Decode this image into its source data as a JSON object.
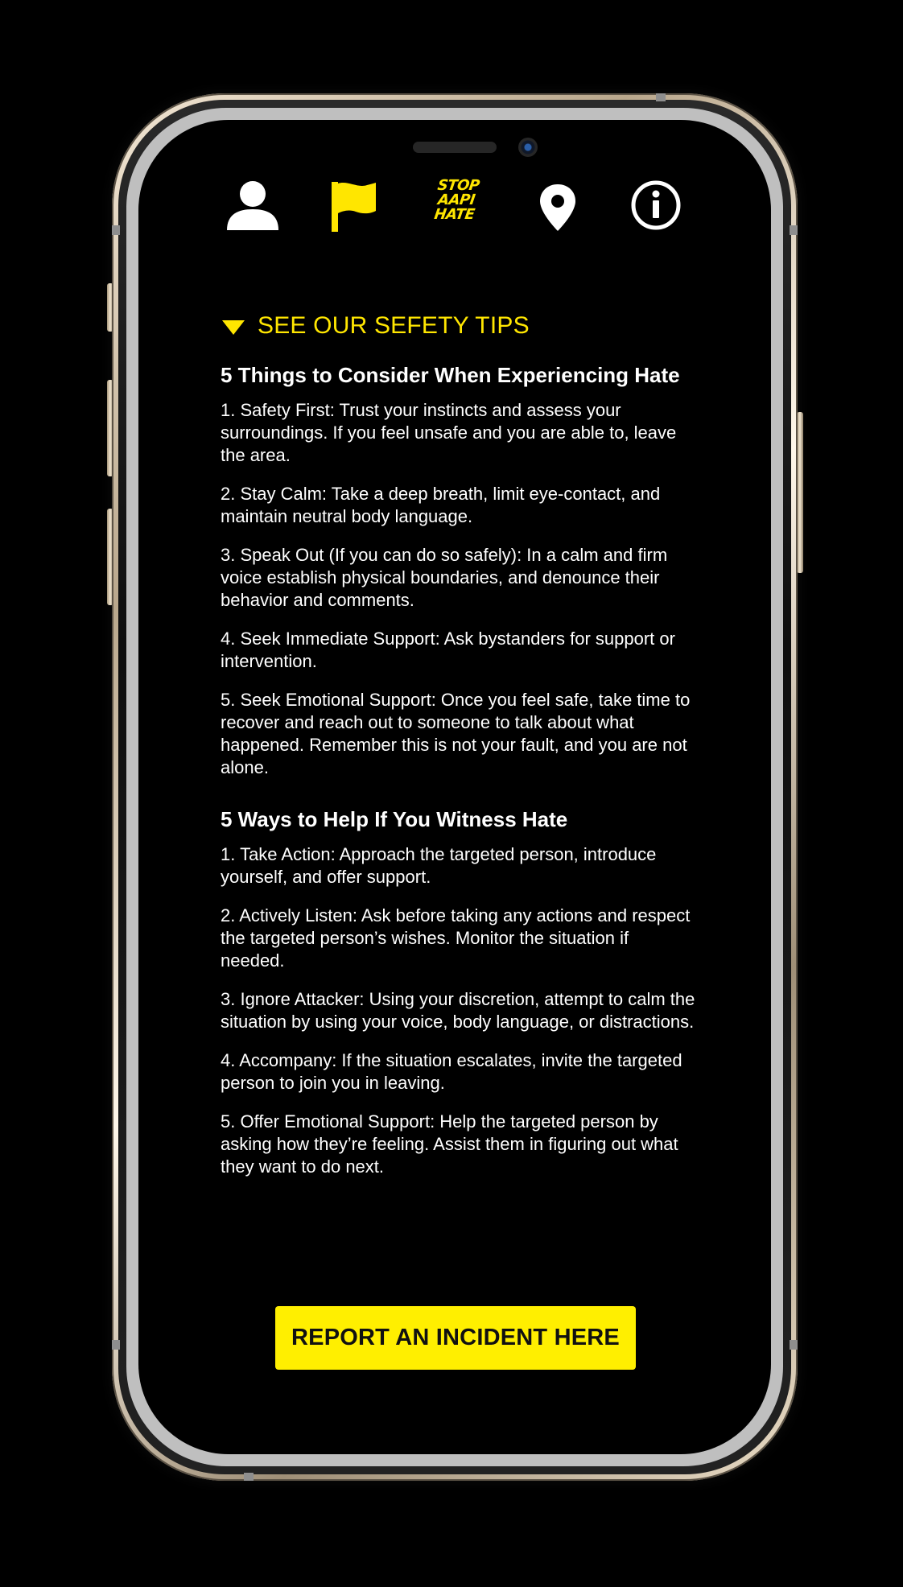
{
  "colors": {
    "accent": "#ffe600",
    "background": "#000000",
    "text": "#ffffff",
    "button_text": "#111111"
  },
  "nav": {
    "items": [
      {
        "name": "profile",
        "icon": "person-icon"
      },
      {
        "name": "report",
        "icon": "flag-icon",
        "active": true
      },
      {
        "name": "home",
        "icon": "stop-aapi-hate-logo"
      },
      {
        "name": "location",
        "icon": "map-pin-icon"
      },
      {
        "name": "info",
        "icon": "info-icon"
      }
    ],
    "logo_lines": [
      "STOP",
      "AAPI",
      "HATE"
    ]
  },
  "tips": {
    "toggle_label": "SEE OUR SEFETY TIPS",
    "experiencing": {
      "title": "5 Things to Consider When Experiencing Hate",
      "items": [
        "1. Safety First: Trust your instincts and assess your surroundings. If you feel unsafe and you are able to, leave the area.",
        "2. Stay Calm: Take a deep breath, limit eye-contact, and maintain neutral body language.",
        "3. Speak Out (If you can do so safely): In a calm and firm voice establish physical boundaries, and denounce their behavior and comments.",
        "4. Seek Immediate Support: Ask bystanders for support or intervention.",
        "5. Seek Emotional Support: Once you feel safe, take time to recover and reach out to someone to talk about what happened. Remember this is not your fault, and you are not alone."
      ]
    },
    "witness": {
      "title": "5 Ways to Help If You Witness Hate",
      "items": [
        "1. Take Action: Approach the targeted person, introduce yourself, and offer support.",
        "2. Actively Listen: Ask before taking any actions and respect the targeted person’s wishes. Monitor the situation if needed.",
        "3. Ignore Attacker: Using your discretion, attempt to calm the situation by using your voice, body language, or distractions.",
        "4. Accompany: If the situation escalates, invite the targeted person to join you in leaving.",
        "5. Offer Emotional Support: Help the targeted person by asking how they’re feeling. Assist them in figuring out what they want to do next."
      ]
    }
  },
  "report_button": {
    "label": "REPORT AN INCIDENT HERE"
  }
}
